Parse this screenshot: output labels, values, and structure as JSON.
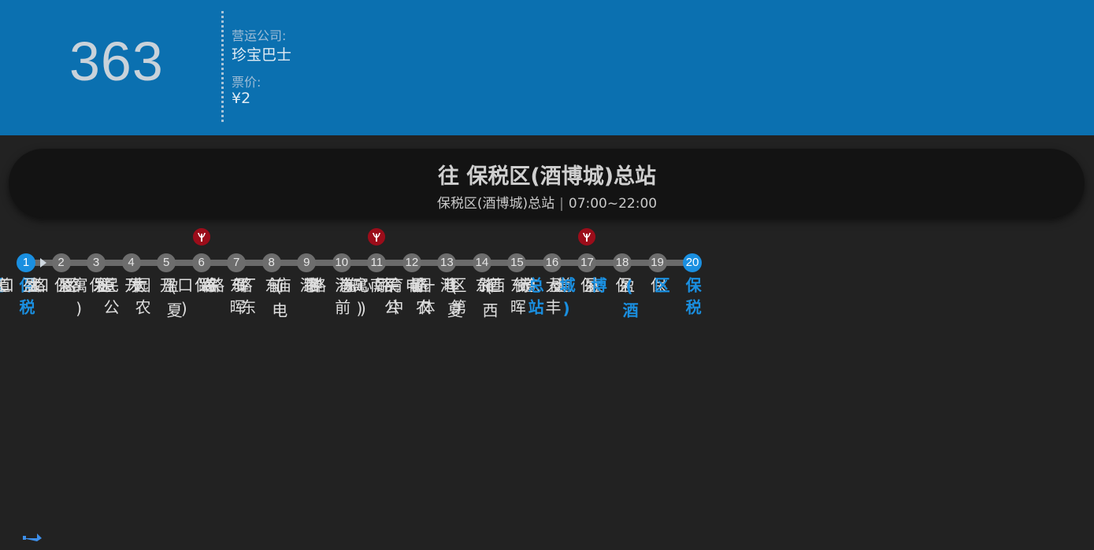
{
  "route": {
    "number": "363",
    "operator_label": "营运公司:",
    "operator": "珍宝巴士",
    "fare_label": "票价:",
    "fare": "¥2"
  },
  "direction": {
    "title": "往 保税区(酒博城)总站",
    "origin": "保税区(酒博城)总站",
    "separator": "|",
    "hours": "07:00~22:00"
  },
  "colors": {
    "header": "#0b70b0",
    "background": "#222222",
    "terminal_accent": "#1a8fe0",
    "metro_badge": "#9b0d1a"
  },
  "stops": [
    {
      "num": "1",
      "name": "保税区(酒博城)总站",
      "terminal": true,
      "metro": false
    },
    {
      "num": "2",
      "name": "保盈大道东",
      "terminal": false,
      "metro": false
    },
    {
      "num": "3",
      "name": "保盈大道西",
      "terminal": false,
      "metro": false
    },
    {
      "num": "4",
      "name": "开发区路口",
      "terminal": false,
      "metro": false
    },
    {
      "num": "5",
      "name": "开发区路口",
      "terminal": false,
      "metro": false
    },
    {
      "num": "6",
      "name": "保盈大道",
      "terminal": false,
      "metro": true
    },
    {
      "num": "7",
      "name": "东晖路(夏园农民公寓)",
      "terminal": false,
      "metro": false
    },
    {
      "num": "8",
      "name": "东晖路",
      "terminal": false,
      "metro": false
    },
    {
      "num": "9",
      "name": "港前路东",
      "terminal": false,
      "metro": false
    },
    {
      "num": "10",
      "name": "港前路(电厂东路口)",
      "terminal": false,
      "metro": false
    },
    {
      "num": "11",
      "name": "南海神庙",
      "terminal": false,
      "metro": true
    },
    {
      "num": "12",
      "name": "电厂东路",
      "terminal": false,
      "metro": false
    },
    {
      "num": "13",
      "name": "港前路东",
      "terminal": false,
      "metro": false
    },
    {
      "num": "14",
      "name": "东晖路",
      "terminal": false,
      "metro": false
    },
    {
      "num": "15",
      "name": "东晖路(夏园农民公寓)",
      "terminal": false,
      "metro": false
    },
    {
      "num": "16",
      "name": "大丰街(西区第一体育中心)",
      "terminal": false,
      "metro": false
    },
    {
      "num": "17",
      "name": "保盈大道",
      "terminal": false,
      "metro": true
    },
    {
      "num": "18",
      "name": "保盈大道西",
      "terminal": false,
      "metro": false
    },
    {
      "num": "19",
      "name": "保盈大道东",
      "terminal": false,
      "metro": false
    },
    {
      "num": "20",
      "name": "保税区(酒博城)总站",
      "terminal": true,
      "metro": false
    }
  ],
  "icons": {
    "metro": "metro-logo-icon",
    "direction": "direction-arrow-icon",
    "corner": "turn-arrow-icon"
  }
}
